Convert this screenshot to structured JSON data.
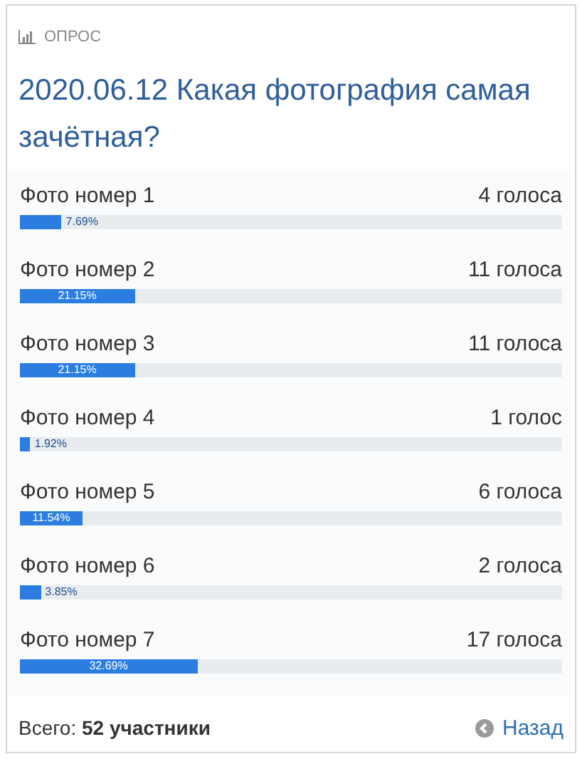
{
  "header": {
    "label": "ОПРОС"
  },
  "title": "2020.06.12 Какая фотография самая зачётная?",
  "options": [
    {
      "name": "Фото номер 1",
      "votes": "4 голоса",
      "level": 0.0769,
      "percent": "7.69%"
    },
    {
      "name": "Фото номер 2",
      "votes": "11 голоса",
      "level": 0.2115,
      "percent": "21.15%"
    },
    {
      "name": "Фото номер 3",
      "votes": "11 голоса",
      "level": 0.2115,
      "percent": "21.15%"
    },
    {
      "name": "Фото номер 4",
      "votes": "1 голос",
      "level": 0.0192,
      "percent": "1.92%"
    },
    {
      "name": "Фото номер 5",
      "votes": "6 голоса",
      "level": 0.1154,
      "percent": "11.54%"
    },
    {
      "name": "Фото номер 6",
      "votes": "2 голоса",
      "level": 0.0385,
      "percent": "3.85%"
    },
    {
      "name": "Фото номер 7",
      "votes": "17 голоса",
      "level": 0.3269,
      "percent": "32.69%"
    }
  ],
  "footer": {
    "total_label": "Всего:",
    "total_value": "52 участники",
    "back_link": "Назад"
  }
}
